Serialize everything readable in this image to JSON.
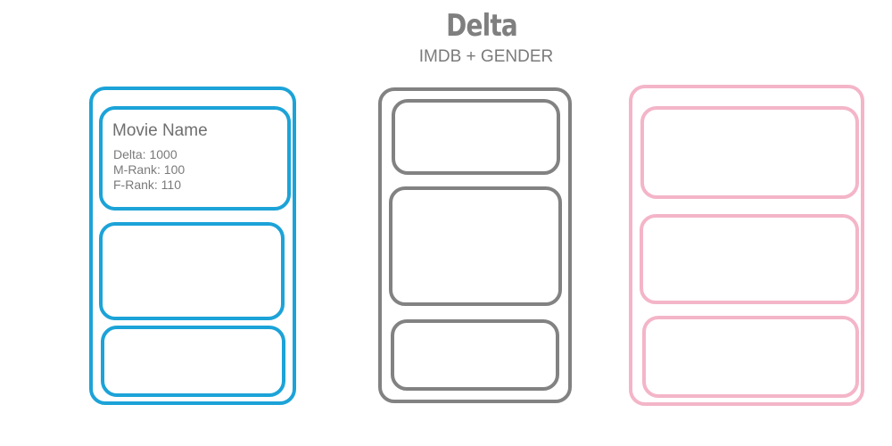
{
  "header": {
    "title": "Delta",
    "subtitle": "IMDB + GENDER"
  },
  "colors": {
    "title": "#7f7f7f",
    "column_left": "#1ca3d8",
    "column_middle": "#828282",
    "column_right": "#f4b5c8"
  },
  "columns": [
    {
      "color": "#1ca3d8",
      "cards": [
        {
          "movie_name": "Movie Name",
          "delta": "Delta: 1000",
          "m_rank": "M-Rank: 100",
          "f_rank": "F-Rank: 110"
        },
        {},
        {}
      ]
    },
    {
      "color": "#828282",
      "cards": [
        {},
        {},
        {}
      ]
    },
    {
      "color": "#f4b5c8",
      "cards": [
        {},
        {},
        {}
      ]
    }
  ]
}
